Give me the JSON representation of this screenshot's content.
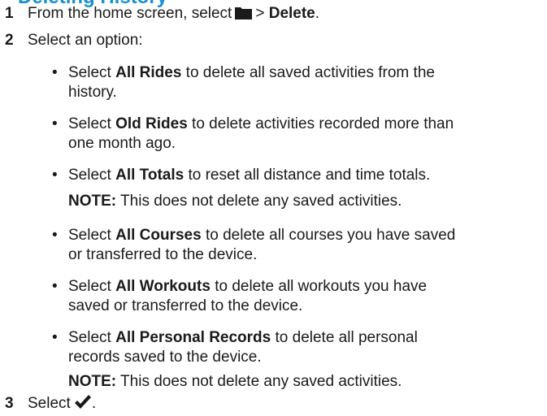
{
  "heading_fragment": "Deleting History",
  "steps": [
    {
      "num": "1",
      "pre": "From the home screen, select",
      "sep": ">",
      "bold": "Delete",
      "post": "."
    },
    {
      "num": "2",
      "text": "Select an option:"
    },
    {
      "num": "3",
      "pre": "Select",
      "post": "."
    }
  ],
  "bullet_char": "•",
  "bullets": [
    {
      "pre": "Select ",
      "bold": "All Rides",
      "post": " to delete all saved activities from the",
      "post2": "history."
    },
    {
      "pre": "Select ",
      "bold": "Old Rides",
      "post": " to delete activities recorded more than",
      "post2": "one month ago."
    },
    {
      "pre": "Select ",
      "bold": "All Totals",
      "post": " to reset all distance and time totals."
    },
    {
      "pre": "Select ",
      "bold": "All Courses",
      "post": " to delete all courses you have saved",
      "post2": "or transferred to the device."
    },
    {
      "pre": "Select ",
      "bold": "All Workouts",
      "post": " to delete all workouts you have",
      "post2": "saved or transferred to the device."
    },
    {
      "pre": "Select ",
      "bold": "All Personal Records",
      "post": " to delete all personal",
      "post2": "records saved to the device."
    }
  ],
  "notes": [
    {
      "label": "NOTE:",
      "text": " This does not delete any saved activities."
    },
    {
      "label": "NOTE:",
      "text": " This does not delete any saved activities."
    }
  ],
  "icons": {
    "step1": "folder-icon",
    "step3": "check-icon"
  }
}
